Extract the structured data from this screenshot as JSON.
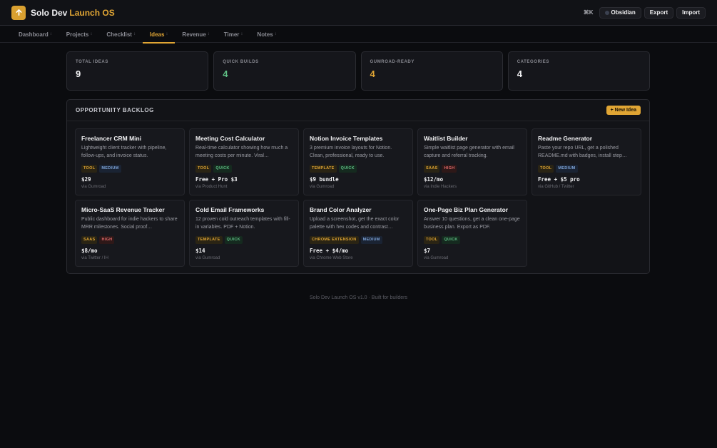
{
  "header": {
    "brand_main": "Solo Dev",
    "brand_accent": "Launch OS",
    "shortcut": "⌘K",
    "vault_label": "Obsidian",
    "export_label": "Export",
    "import_label": "Import"
  },
  "nav": {
    "tabs": [
      {
        "label": "Dashboard",
        "icon": "↕"
      },
      {
        "label": "Projects",
        "icon": "↕"
      },
      {
        "label": "Checklist",
        "icon": "↕"
      },
      {
        "label": "Ideas",
        "icon": "↕"
      },
      {
        "label": "Revenue",
        "icon": "↕"
      },
      {
        "label": "Timer",
        "icon": "↕"
      },
      {
        "label": "Notes",
        "icon": "↕"
      }
    ],
    "active": "Ideas"
  },
  "stats": [
    {
      "label": "TOTAL IDEAS",
      "value": "9",
      "color": "#f2f2f4"
    },
    {
      "label": "QUICK BUILDS",
      "value": "4",
      "color": "#5fbf85"
    },
    {
      "label": "GUMROAD-READY",
      "value": "4",
      "color": "#e0a534"
    },
    {
      "label": "CATEGORIES",
      "value": "4",
      "color": "#f2f2f4"
    }
  ],
  "backlog": {
    "title": "OPPORTUNITY BACKLOG",
    "new_button": "+ New Idea",
    "ideas": [
      {
        "title": "Freelancer CRM Mini",
        "desc": "Lightweight client tracker with pipeline, follow-ups, and invoice status.",
        "badges": [
          "TOOL",
          "MEDIUM"
        ],
        "price": "$29",
        "source": "via Gumroad"
      },
      {
        "title": "Meeting Cost Calculator",
        "desc": "Real-time calculator showing how much a meeting costs per minute. Viral…",
        "badges": [
          "TOOL",
          "QUICK"
        ],
        "price": "Free + Pro $3",
        "source": "via Product Hunt"
      },
      {
        "title": "Notion Invoice Templates",
        "desc": "3 premium invoice layouts for Notion. Clean, professional, ready to use.",
        "badges": [
          "TEMPLATE",
          "QUICK"
        ],
        "price": "$9 bundle",
        "source": "via Gumroad"
      },
      {
        "title": "Waitlist Builder",
        "desc": "Simple waitlist page generator with email capture and referral tracking.",
        "badges": [
          "SAAS",
          "HIGH"
        ],
        "price": "$12/mo",
        "source": "via Indie Hackers"
      },
      {
        "title": "Readme Generator",
        "desc": "Paste your repo URL, get a polished README.md with badges, install step…",
        "badges": [
          "TOOL",
          "MEDIUM"
        ],
        "price": "Free + $5 pro",
        "source": "via GitHub / Twitter"
      },
      {
        "title": "Micro-SaaS Revenue Tracker",
        "desc": "Public dashboard for indie hackers to share MRR milestones. Social proof…",
        "badges": [
          "SAAS",
          "HIGH"
        ],
        "price": "$8/mo",
        "source": "via Twitter / IH"
      },
      {
        "title": "Cold Email Frameworks",
        "desc": "12 proven cold outreach templates with fill-in variables. PDF + Notion.",
        "badges": [
          "TEMPLATE",
          "QUICK"
        ],
        "price": "$14",
        "source": "via Gumroad"
      },
      {
        "title": "Brand Color Analyzer",
        "desc": "Upload a screenshot, get the exact color palette with hex codes and contrast…",
        "badges": [
          "CHROME EXTENSION",
          "MEDIUM"
        ],
        "price": "Free + $4/mo",
        "source": "via Chrome Web Store"
      },
      {
        "title": "One-Page Biz Plan Generator",
        "desc": "Answer 10 questions, get a clean one-page business plan. Export as PDF.",
        "badges": [
          "TOOL",
          "QUICK"
        ],
        "price": "$7",
        "source": "via Gumroad"
      }
    ]
  },
  "footer": "Solo Dev Launch OS v1.0 · Built for builders",
  "colors": {
    "accent": "#e0a534",
    "quick": "#5fbf85",
    "medium": "#7ea4d8",
    "high": "#e06a6a"
  }
}
